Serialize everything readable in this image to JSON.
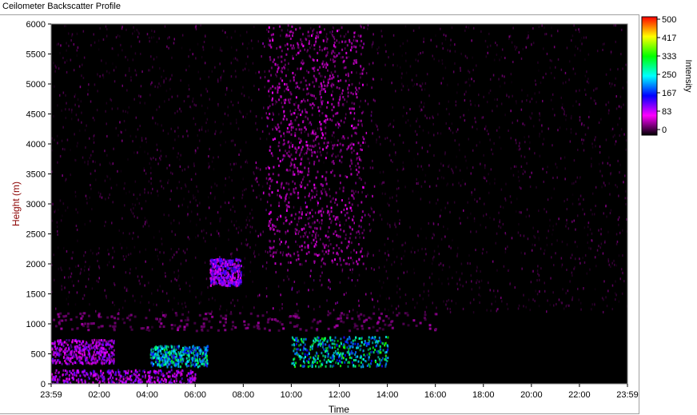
{
  "window": {
    "title": "Ceilometer Backscatter Profile"
  },
  "colorbar": {
    "label": "Intensity",
    "ticks": [
      "500",
      "417",
      "333",
      "250",
      "167",
      "83",
      "0"
    ],
    "stops": [
      "#000000",
      "#ff00ff",
      "#0000ff",
      "#00ffff",
      "#00ff00",
      "#ffff00",
      "#ff0000"
    ]
  },
  "chart_data": {
    "type": "heatmap",
    "title": "",
    "xlabel": "Time",
    "ylabel": "Height (m)",
    "xlim": [
      "23:59",
      "23:59"
    ],
    "ylim": [
      0,
      6000
    ],
    "x_ticks": [
      "23:59",
      "02:00",
      "04:00",
      "06:00",
      "08:00",
      "10:00",
      "12:00",
      "14:00",
      "16:00",
      "18:00",
      "20:00",
      "22:00",
      "23:59"
    ],
    "y_ticks": [
      0,
      500,
      1000,
      1500,
      2000,
      2500,
      3000,
      3500,
      4000,
      4500,
      5000,
      5500,
      6000
    ],
    "intensity_range": [
      0,
      500
    ],
    "background_color": "#000000",
    "noise_color": "#ff00ff",
    "features": [
      {
        "kind": "surface-layer",
        "t_start": 0.0,
        "t_end": 6.0,
        "h_low": 0,
        "h_high": 250,
        "intensity": 120
      },
      {
        "kind": "residual-layer",
        "t_start": 0.0,
        "t_end": 2.6,
        "h_low": 350,
        "h_high": 750,
        "intensity": 110
      },
      {
        "kind": "boundary-layer-top",
        "t_start": 0.0,
        "t_end": 16.0,
        "h_low": 900,
        "h_high": 1200,
        "intensity": 45
      },
      {
        "kind": "cloud",
        "t_start": 4.1,
        "t_end": 6.5,
        "h_low": 300,
        "h_high": 650,
        "intensity": 260
      },
      {
        "kind": "elevated-aerosol",
        "t_start": 6.6,
        "t_end": 7.9,
        "h_low": 1650,
        "h_high": 2100,
        "intensity": 130
      },
      {
        "kind": "cloud",
        "t_start": 10.0,
        "t_end": 14.0,
        "h_low": 300,
        "h_high": 800,
        "intensity": 280
      },
      {
        "kind": "high-noise-region",
        "t_start": 9.0,
        "t_end": 13.0,
        "h_low": 2000,
        "h_high": 6000,
        "intensity": 70
      }
    ]
  }
}
